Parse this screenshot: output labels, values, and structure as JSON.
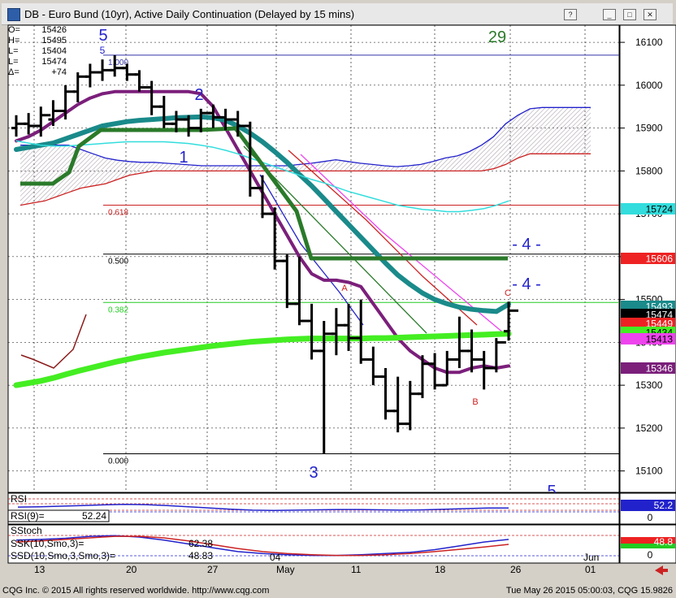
{
  "window": {
    "title": "DB - Euro Bund (10yr), Active Daily Continuation (Delayed by 15 mins)",
    "buttons": [
      "help-button",
      "minimize-button",
      "maximize-button",
      "close-button"
    ]
  },
  "ohlc_readout": [
    {
      "key": "O=",
      "value": "15426"
    },
    {
      "key": "H=",
      "value": "15495"
    },
    {
      "key": "L=",
      "value": "15404"
    },
    {
      "key": "L=",
      "value": "15474"
    },
    {
      "key": "Δ=",
      "value": "+74"
    }
  ],
  "footer": {
    "left": "CQG Inc. © 2015 All rights reserved worldwide. http://www.cqg.com",
    "right": "Tue May 26 2015 05:00:03, CQG 15.9826"
  },
  "colors": {
    "background": "#ffffff",
    "window": "#d4d0c8",
    "bars": "#000000",
    "cloud": "#d0c4cc",
    "ma_purple": "#7b1f7b",
    "ma_teal": "#1a8a8a",
    "ma_green_thick": "#44ee22",
    "ma_darkgreen": "#2a7a2a",
    "cyan": "#33dddd",
    "blue_line": "#2222cc",
    "red_line": "#cc2222",
    "magenta": "#ee44ee",
    "fib_100": "#3333aa",
    "fib_618": "#cc2222",
    "fib_500": "#000000",
    "fib_382": "#22cc22",
    "fib_000": "#000000"
  },
  "chart_data": [
    {
      "type": "bar",
      "title": "DB - Euro Bund (10yr), Active Daily Continuation (Delayed by 15 mins)",
      "x_ticks": [
        "13",
        "20",
        "27",
        "May",
        "04",
        "11",
        "18",
        "26",
        "Jun",
        "01"
      ],
      "ylim": [
        15050,
        16140
      ],
      "y_ticks": [
        15100,
        15200,
        15300,
        15400,
        15500,
        15600,
        15700,
        15800,
        15900,
        16000,
        16100
      ],
      "bars": [
        {
          "o": 15900,
          "h": 15930,
          "l": 15880,
          "c": 15910
        },
        {
          "o": 15910,
          "h": 15935,
          "l": 15885,
          "c": 15905
        },
        {
          "o": 15905,
          "h": 15950,
          "l": 15880,
          "c": 15930
        },
        {
          "o": 15920,
          "h": 15965,
          "l": 15905,
          "c": 15940
        },
        {
          "o": 15940,
          "h": 16000,
          "l": 15920,
          "c": 15985
        },
        {
          "o": 15985,
          "h": 16030,
          "l": 15960,
          "c": 16020
        },
        {
          "o": 16020,
          "h": 16050,
          "l": 15995,
          "c": 16030
        },
        {
          "o": 16030,
          "h": 16060,
          "l": 16010,
          "c": 16035
        },
        {
          "o": 16035,
          "h": 16070,
          "l": 16020,
          "c": 16040
        },
        {
          "o": 16040,
          "h": 16050,
          "l": 16010,
          "c": 16025
        },
        {
          "o": 16025,
          "h": 16035,
          "l": 15985,
          "c": 15995
        },
        {
          "o": 15995,
          "h": 16010,
          "l": 15930,
          "c": 15950
        },
        {
          "o": 15950,
          "h": 15975,
          "l": 15900,
          "c": 15910
        },
        {
          "o": 15910,
          "h": 15940,
          "l": 15890,
          "c": 15920
        },
        {
          "o": 15920,
          "h": 15930,
          "l": 15880,
          "c": 15900
        },
        {
          "o": 15900,
          "h": 15945,
          "l": 15890,
          "c": 15935
        },
        {
          "o": 15935,
          "h": 15955,
          "l": 15900,
          "c": 15925
        },
        {
          "o": 15925,
          "h": 15945,
          "l": 15895,
          "c": 15920
        },
        {
          "o": 15920,
          "h": 15940,
          "l": 15880,
          "c": 15905
        },
        {
          "o": 15905,
          "h": 15915,
          "l": 15740,
          "c": 15760
        },
        {
          "o": 15760,
          "h": 15790,
          "l": 15690,
          "c": 15700
        },
        {
          "o": 15700,
          "h": 15715,
          "l": 15570,
          "c": 15590
        },
        {
          "o": 15590,
          "h": 15605,
          "l": 15480,
          "c": 15490
        },
        {
          "o": 15490,
          "h": 15600,
          "l": 15440,
          "c": 15450
        },
        {
          "o": 15450,
          "h": 15490,
          "l": 15360,
          "c": 15380
        },
        {
          "o": 15380,
          "h": 15450,
          "l": 15140,
          "c": 15420
        },
        {
          "o": 15420,
          "h": 15480,
          "l": 15370,
          "c": 15440
        },
        {
          "o": 15440,
          "h": 15490,
          "l": 15380,
          "c": 15410
        },
        {
          "o": 15410,
          "h": 15500,
          "l": 15350,
          "c": 15360
        },
        {
          "o": 15360,
          "h": 15390,
          "l": 15300,
          "c": 15320
        },
        {
          "o": 15320,
          "h": 15340,
          "l": 15220,
          "c": 15240
        },
        {
          "o": 15240,
          "h": 15320,
          "l": 15190,
          "c": 15210
        },
        {
          "o": 15210,
          "h": 15310,
          "l": 15195,
          "c": 15280
        },
        {
          "o": 15280,
          "h": 15370,
          "l": 15270,
          "c": 15350
        },
        {
          "o": 15350,
          "h": 15375,
          "l": 15290,
          "c": 15300
        },
        {
          "o": 15300,
          "h": 15380,
          "l": 15300,
          "c": 15360
        },
        {
          "o": 15360,
          "h": 15460,
          "l": 15340,
          "c": 15380
        },
        {
          "o": 15380,
          "h": 15430,
          "l": 15330,
          "c": 15360
        },
        {
          "o": 15360,
          "h": 15380,
          "l": 15290,
          "c": 15340
        },
        {
          "o": 15340,
          "h": 15410,
          "l": 15330,
          "c": 15400
        },
        {
          "o": 15426,
          "h": 15495,
          "l": 15404,
          "c": 15474
        }
      ],
      "moving_averages": [
        {
          "color": "#7b1f7b",
          "width": 4,
          "values": [
            15870,
            15880,
            15895,
            15915,
            15935,
            15955,
            15970,
            15980,
            15985,
            15985,
            15985,
            15985,
            15985,
            15985,
            15985,
            15980,
            15950,
            15900,
            15850,
            15800,
            15750,
            15700,
            15650,
            15600,
            15560,
            15545,
            15545,
            15540,
            15530,
            15490,
            15450,
            15410,
            15380,
            15360,
            15340,
            15330,
            15330,
            15340,
            15345,
            15340,
            15345
          ]
        },
        {
          "color": "#1a8a8a",
          "width": 6,
          "values": [
            15850,
            15855,
            15860,
            15865,
            15875,
            15885,
            15895,
            15905,
            15910,
            15915,
            15918,
            15920,
            15922,
            15924,
            15925,
            15926,
            15924,
            15918,
            15905,
            15888,
            15868,
            15845,
            15820,
            15792,
            15765,
            15735,
            15705,
            15675,
            15645,
            15615,
            15585,
            15557,
            15535,
            15515,
            15500,
            15490,
            15482,
            15477,
            15474,
            15472,
            15489
          ]
        },
        {
          "color": "#44ee22",
          "width": 7,
          "values": [
            15300,
            15305,
            15310,
            15317,
            15325,
            15333,
            15340,
            15347,
            15354,
            15360,
            15366,
            15371,
            15376,
            15380,
            15384,
            15388,
            15392,
            15395,
            15398,
            15401,
            15403,
            15405,
            15407,
            15408,
            15409,
            15409,
            15409,
            15409,
            15409,
            15410,
            15410,
            15411,
            15412,
            15413,
            15414,
            15415,
            15416,
            15417,
            15418,
            15419,
            15420
          ]
        },
        {
          "color": "#33dddd",
          "width": 1.5,
          "values": [
            15870,
            15865,
            15860,
            15858,
            15858,
            15860,
            15862,
            15864,
            15866,
            15868,
            15868,
            15868,
            15868,
            15866,
            15864,
            15860,
            15855,
            15848,
            15840,
            15830,
            15820,
            15810,
            15800,
            15790,
            15780,
            15772,
            15762,
            15752,
            15744,
            15736,
            15728,
            15720,
            15715,
            15710,
            15708,
            15705,
            15705,
            15708,
            15712,
            15720,
            15730
          ]
        }
      ],
      "fib_levels": [
        {
          "label": "1.000",
          "value": 16070,
          "color": "#3333aa"
        },
        {
          "label": "0.618",
          "value": 15720,
          "color": "#cc2222"
        },
        {
          "label": "0.500",
          "value": 15606,
          "color": "#000000"
        },
        {
          "label": "0.382",
          "value": 15493,
          "color": "#22cc22"
        },
        {
          "label": "0.000",
          "value": 15140,
          "color": "#000000"
        }
      ],
      "price_tags": [
        {
          "label": "15724",
          "bg": "#33dddd",
          "fg": "#000000",
          "value": 15724
        },
        {
          "label": "15606",
          "bg": "#ee2222",
          "fg": "#ffffff",
          "value": 15606
        },
        {
          "label": "15493",
          "bg": "#1a8a8a",
          "fg": "#ffffff",
          "value": 15493
        },
        {
          "label": "15474",
          "bg": "#000000",
          "fg": "#ffffff",
          "value": 15474
        },
        {
          "label": "15449",
          "bg": "#ee2222",
          "fg": "#ffffff",
          "value": 15449
        },
        {
          "label": "15434",
          "bg": "#44ee22",
          "fg": "#000000",
          "value": 15434
        },
        {
          "label": "15413",
          "bg": "#ee44ee",
          "fg": "#000000",
          "value": 15413
        },
        {
          "label": "15346",
          "bg": "#7b1f7b",
          "fg": "#ffffff",
          "value": 15346
        }
      ],
      "wave_labels": [
        {
          "text": "5",
          "color": "#2222cc",
          "size": 20
        },
        {
          "text": "5",
          "color": "#2222cc",
          "size": 12
        },
        {
          "text": "29",
          "color": "#2a7a2a",
          "size": 20
        },
        {
          "text": "2",
          "color": "#2222cc",
          "size": 20
        },
        {
          "text": "1",
          "color": "#2222cc",
          "size": 20
        },
        {
          "text": "3",
          "color": "#2222cc",
          "size": 20
        },
        {
          "text": "- 4 -",
          "color": "#2222cc",
          "size": 20
        },
        {
          "text": "- 4 -",
          "color": "#2222cc",
          "size": 20
        },
        {
          "text": "A",
          "color": "#cc2222",
          "size": 11
        },
        {
          "text": "B",
          "color": "#cc2222",
          "size": 11
        },
        {
          "text": "C",
          "color": "#cc2222",
          "size": 11
        },
        {
          "text": "5",
          "color": "#2222cc",
          "size": 20
        }
      ]
    },
    {
      "type": "line",
      "title": "RSI",
      "label": "RSI(9)=",
      "value": "52.24",
      "tag": "52.2",
      "ylim": [
        0,
        100
      ],
      "y_ticks": [
        0
      ],
      "values": [
        55,
        56,
        58,
        60,
        62,
        64,
        63,
        60,
        56,
        52,
        48,
        45,
        44,
        45,
        46,
        47,
        47,
        46,
        45,
        46,
        48,
        50,
        52,
        52
      ]
    },
    {
      "type": "line",
      "title": "SStoch",
      "series": [
        {
          "name": "SSK(10,Smo,3)=",
          "value": "62.38",
          "tag": "",
          "values": [
            60,
            62,
            65,
            70,
            72,
            68,
            60,
            50,
            40,
            30,
            25,
            22,
            20,
            20,
            22,
            25,
            28,
            35,
            45,
            55,
            62
          ]
        },
        {
          "name": "SSD(10,Smo,3,Smo,3)=",
          "value": "48.83",
          "tag": "48.8",
          "values": [
            55,
            58,
            62,
            66,
            70,
            70,
            66,
            58,
            48,
            38,
            30,
            25,
            22,
            20,
            20,
            22,
            25,
            30,
            36,
            42,
            49
          ]
        }
      ],
      "ylim": [
        0,
        100
      ],
      "y_ticks": [
        0
      ]
    }
  ]
}
